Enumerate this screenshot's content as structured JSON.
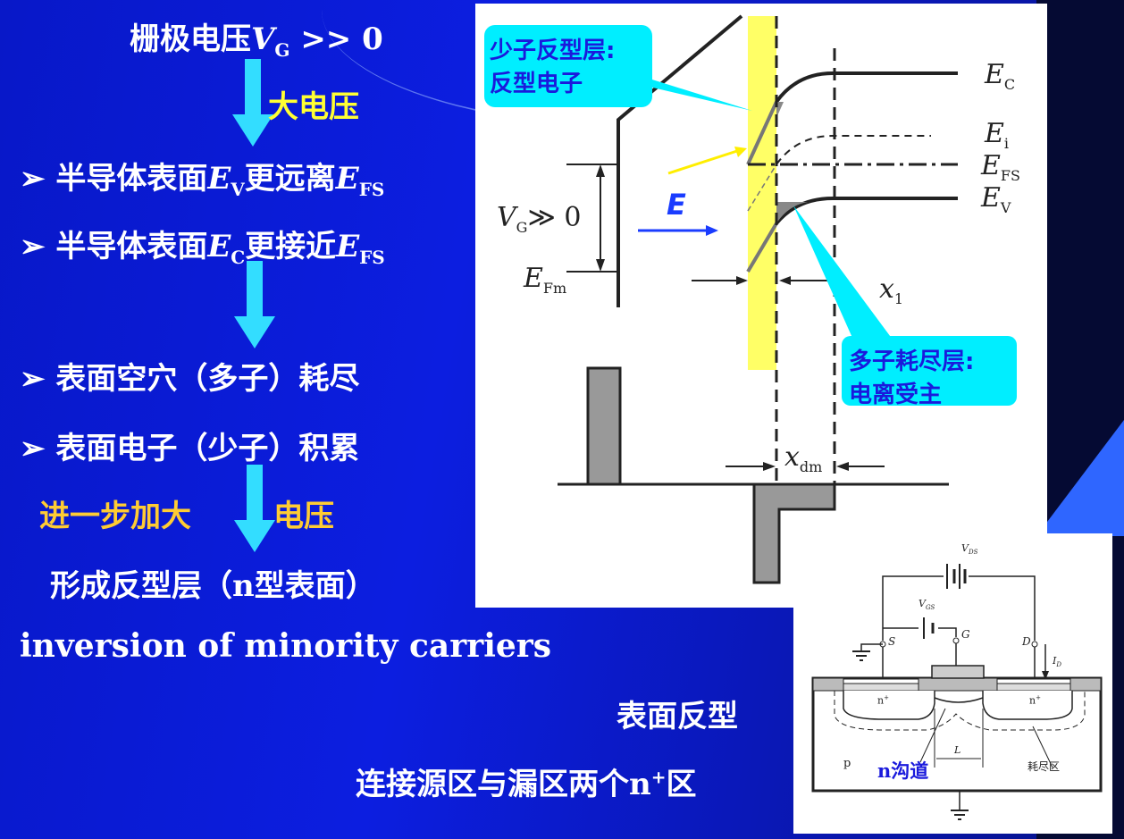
{
  "left": {
    "title_prefix": "栅极电压",
    "title_V": "V",
    "title_sub": "G",
    "title_suffix": " >> 0",
    "arrow1_label": "大电压",
    "bullet_char": "➢",
    "line1_prefix": "半导体表面",
    "line1_E1": "E",
    "line1_sub1": "V",
    "line1_mid": "更远离",
    "line1_E2": "E",
    "line1_sub2": "FS",
    "line2_prefix": "半导体表面",
    "line2_E1": "E",
    "line2_sub1": "C",
    "line2_mid": "更接近",
    "line2_E2": "E",
    "line2_sub2": "FS",
    "line3": "表面空穴（多子）耗尽",
    "line4": "表面电子（少子）积累",
    "further_left": "进一步加大",
    "further_right": "电压",
    "result": "形成反型层（n型表面）",
    "english": "inversion of minority carriers",
    "surface_inversion": "表面反型",
    "connect": "连接源区与漏区两个n",
    "connect_sup": "+",
    "connect_end": "区"
  },
  "band_diagram": {
    "callout_top_line1": "少子反型层:",
    "callout_top_line2": "反型电子",
    "callout_bottom_line1": "多子耗尽层:",
    "callout_bottom_line2": "电离受主",
    "E_label": "E",
    "Ec": "E",
    "Ec_sub": "C",
    "Ei": "E",
    "Ei_sub": "i",
    "Efs": "E",
    "Efs_sub": "FS",
    "Ev": "E",
    "Ev_sub": "V",
    "vg": "V",
    "vg_sub": "G",
    "vg_rel": "≫ 0",
    "efm": "E",
    "efm_sub": "Fm",
    "x1": "x",
    "x1_sub": "1",
    "xdm": "x",
    "xdm_sub": "dm"
  },
  "mos_diagram": {
    "vds": "V",
    "vds_sub": "DS",
    "vgs": "V",
    "vgs_sub": "GS",
    "S": "S",
    "G": "G",
    "D": "D",
    "id": "I",
    "id_sub": "D",
    "n_left": "n",
    "n_right": "n",
    "n_sup": "+",
    "p": "p",
    "channel": "n沟道",
    "L": "L",
    "depletion": "耗尽区"
  },
  "colors": {
    "background": "#0c1ee0",
    "callout": "#00eeff",
    "highlight": "#ffff66",
    "arrow": "#33ddff"
  }
}
